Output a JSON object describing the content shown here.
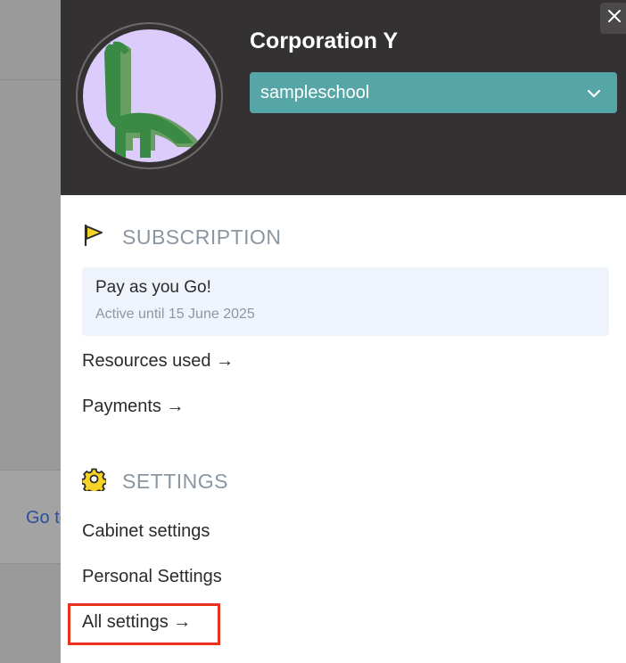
{
  "background": {
    "link_text": "Go to"
  },
  "header": {
    "organization_name": "Corporation Y",
    "school_select": {
      "selected": "sampleschool"
    },
    "close_icon": "close-icon",
    "avatar_icon": "dinosaur-avatar"
  },
  "subscription": {
    "title": "SUBSCRIPTION",
    "icon": "flag-icon",
    "plan_name": "Pay as you Go!",
    "plan_status": "Active until 15 June 2025",
    "links": {
      "resources": "Resources used →",
      "payments": "Payments →"
    }
  },
  "settings": {
    "title": "SETTINGS",
    "icon": "gear-icon",
    "links": {
      "cabinet": "Cabinet settings",
      "personal": "Personal Settings",
      "all": "All settings →"
    }
  },
  "colors": {
    "header_bg": "#333132",
    "select_bg": "#56a6a7",
    "avatar_bg": "#dcccfb",
    "dino_green": "#3a8a45",
    "plan_card_bg": "#eff4fc",
    "highlight": "#e8321e",
    "section_label": "#8b96a3"
  }
}
